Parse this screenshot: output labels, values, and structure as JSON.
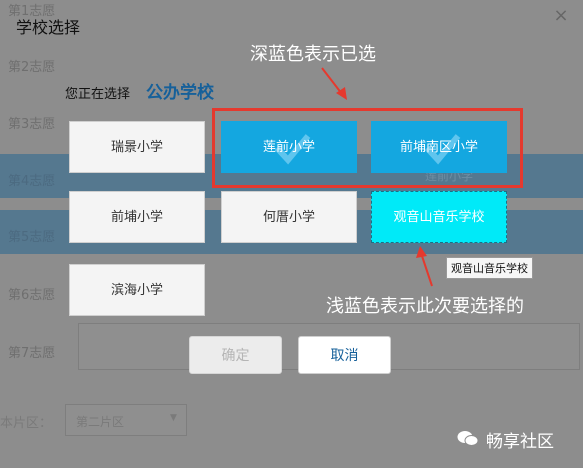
{
  "background": {
    "choices": [
      "第1志愿",
      "第2志愿",
      "第3志愿",
      "第4志愿",
      "第5志愿",
      "第6志愿",
      "第7志愿"
    ],
    "selected_school_text": "莲前小学",
    "district_label": "本片区：",
    "district_value": "第二片区"
  },
  "dialog": {
    "title": "学校选择",
    "selecting_label": "您正在选择",
    "selecting_value": "公办学校"
  },
  "annotations": {
    "dark_blue": "深蓝色表示已选",
    "light_blue": "浅蓝色表示此次要选择的"
  },
  "schools": [
    {
      "name": "瑞景小学",
      "state": "normal"
    },
    {
      "name": "莲前小学",
      "state": "selected"
    },
    {
      "name": "前埔南区小学",
      "state": "selected"
    },
    {
      "name": "前埔小学",
      "state": "normal"
    },
    {
      "name": "何厝小学",
      "state": "normal"
    },
    {
      "name": "观音山音乐学校",
      "state": "selecting"
    },
    {
      "name": "滨海小学",
      "state": "normal"
    }
  ],
  "tooltip": "观音山音乐学校",
  "buttons": {
    "confirm": "确定",
    "cancel": "取消"
  },
  "watermark": "畅享社区",
  "colors": {
    "selected": "#14a7e0",
    "selecting": "#00eaf8",
    "highlight_box": "#e5392e",
    "accent_text": "#16609a"
  }
}
